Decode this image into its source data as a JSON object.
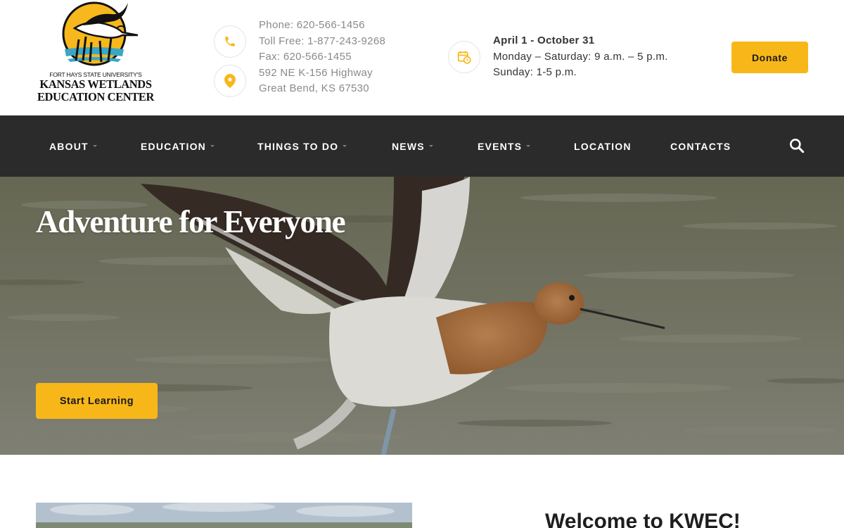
{
  "logo": {
    "line1": "FORT HAYS STATE UNIVERSITY'S",
    "line2": "KANSAS WETLANDS",
    "line3": "EDUCATION CENTER"
  },
  "contact": {
    "phone": "Phone: 620-566-1456",
    "toll_free": "Toll Free: 1-877-243-9268",
    "fax": "Fax: 620-566-1455",
    "address_line1": "592 NE K-156 Highway",
    "address_line2": "Great Bend, KS 67530",
    "phone_icon": "phone-icon",
    "location_icon": "map-pin-icon"
  },
  "hours": {
    "dates": "April 1 - October 31",
    "weekday": "Monday – Saturday: 9 a.m. – 5 p.m.",
    "sunday": "Sunday: 1-5 p.m.",
    "icon": "calendar-clock-icon"
  },
  "donate_label": "Donate",
  "nav": {
    "items": [
      {
        "label": "ABOUT",
        "has_dropdown": true
      },
      {
        "label": "EDUCATION",
        "has_dropdown": true
      },
      {
        "label": "THINGS TO DO",
        "has_dropdown": true
      },
      {
        "label": "NEWS",
        "has_dropdown": true
      },
      {
        "label": "EVENTS",
        "has_dropdown": true
      },
      {
        "label": "LOCATION",
        "has_dropdown": false
      },
      {
        "label": "CONTACTS",
        "has_dropdown": false
      }
    ],
    "search_icon": "search-icon"
  },
  "hero": {
    "title": "Adventure for Everyone",
    "cta_label": "Start Learning"
  },
  "welcome": {
    "heading": "Welcome to KWEC!"
  },
  "colors": {
    "accent": "#f8b719",
    "nav_bg": "#2b2b2b",
    "text_muted": "#8a8a8a"
  }
}
